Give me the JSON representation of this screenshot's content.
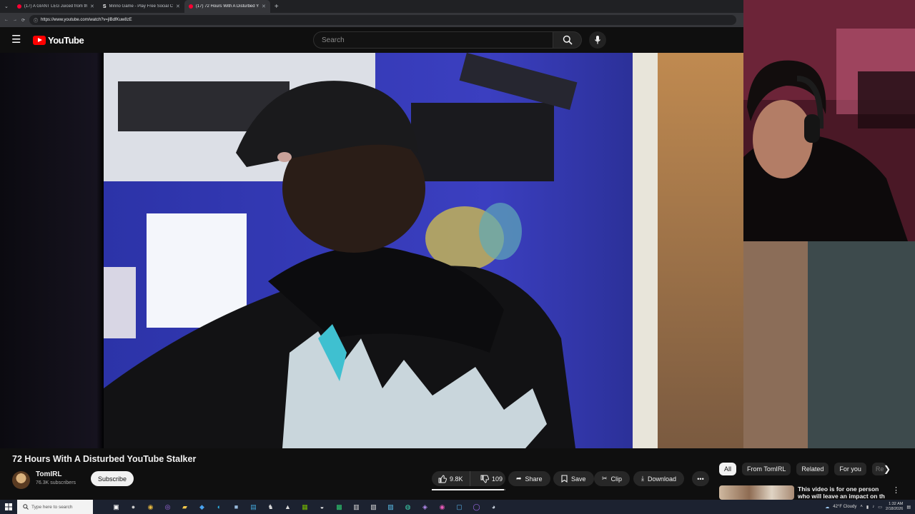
{
  "browser": {
    "tabs": [
      {
        "title": "(17) A GIANT LEG Juiced from the",
        "active": false
      },
      {
        "title": "Minno Game - Play Free Social Co",
        "active": false
      },
      {
        "title": "(17) 72 Hours With A Disturbed Yo",
        "active": true
      }
    ],
    "new_tab": "+",
    "url": "https://www.youtube.com/watch?v=jlBdfKuw8zE"
  },
  "youtube": {
    "logo_text": "YouTube",
    "search_placeholder": "Search"
  },
  "video": {
    "title": "72 Hours With A Disturbed YouTube Stalker",
    "channel": "TomIRL",
    "subscribers": "76.3K subscribers",
    "subscribe_label": "Subscribe",
    "likes": "9.8K",
    "dislikes": "109",
    "share_label": "Share",
    "save_label": "Save",
    "clip_label": "Clip",
    "download_label": "Download"
  },
  "sidebar": {
    "chips": [
      "All",
      "From TomIRL",
      "Related",
      "For you",
      "Re"
    ],
    "recommendation_title": "This video is for one person who will leave an impact on th"
  },
  "taskbar": {
    "search_placeholder": "Type here to search",
    "weather": "42°F  Cloudy",
    "time": "1:32 AM",
    "date": "2/18/2026"
  },
  "colors": {
    "youtube_red": "#ff0000",
    "background": "#0f0f0f",
    "chip_active": "#f1f1f1"
  }
}
